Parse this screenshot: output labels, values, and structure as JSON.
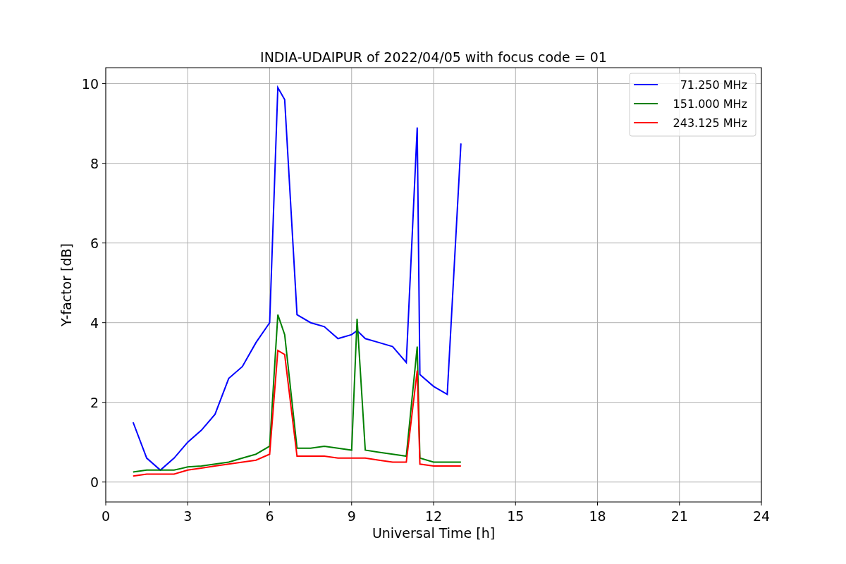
{
  "figure": {
    "chart_data": {
      "type": "line",
      "title": "INDIA-UDAIPUR of 2022/04/05 with focus code = 01",
      "xlabel": "Universal Time [h]",
      "ylabel": "Y-factor [dB]",
      "x": [
        1,
        1.5,
        2,
        2.5,
        3,
        3.5,
        4,
        4.5,
        5,
        5.5,
        6,
        6.3,
        6.55,
        7,
        7.5,
        8,
        8.5,
        9,
        9.2,
        9.5,
        10,
        10.5,
        11,
        11.4,
        11.5,
        12,
        12.5,
        13
      ],
      "series": [
        {
          "name": "71.250 MHz",
          "color": "#0000ff",
          "values": [
            1.5,
            0.6,
            0.3,
            0.6,
            1.0,
            1.3,
            1.7,
            2.6,
            2.9,
            3.5,
            4.0,
            9.9,
            9.6,
            4.2,
            4.0,
            3.9,
            3.6,
            3.7,
            3.8,
            3.6,
            3.5,
            3.4,
            3.0,
            8.9,
            2.7,
            2.4,
            2.2,
            8.5
          ]
        },
        {
          "name": "151.000 MHz",
          "color": "#008000",
          "values": [
            0.25,
            0.3,
            0.3,
            0.3,
            0.38,
            0.4,
            0.45,
            0.5,
            0.6,
            0.7,
            0.9,
            4.2,
            3.7,
            0.85,
            0.85,
            0.9,
            0.85,
            0.8,
            4.1,
            0.8,
            0.75,
            0.7,
            0.65,
            3.4,
            0.6,
            0.5,
            0.5,
            0.5
          ]
        },
        {
          "name": "243.125 MHz",
          "color": "#ff0000",
          "values": [
            0.15,
            0.2,
            0.2,
            0.2,
            0.3,
            0.35,
            0.4,
            0.45,
            0.5,
            0.55,
            0.7,
            3.3,
            3.2,
            0.65,
            0.65,
            0.65,
            0.6,
            0.6,
            0.6,
            0.6,
            0.55,
            0.5,
            0.5,
            2.8,
            0.45,
            0.4,
            0.4,
            0.4
          ]
        }
      ],
      "grid": true,
      "legend": true,
      "xlim": [
        0,
        24
      ],
      "ylim": [
        -0.5,
        10.4
      ],
      "xticks": [
        0,
        3,
        6,
        9,
        12,
        15,
        18,
        21,
        24
      ],
      "yticks": [
        0,
        2,
        4,
        6,
        8,
        10
      ]
    }
  }
}
